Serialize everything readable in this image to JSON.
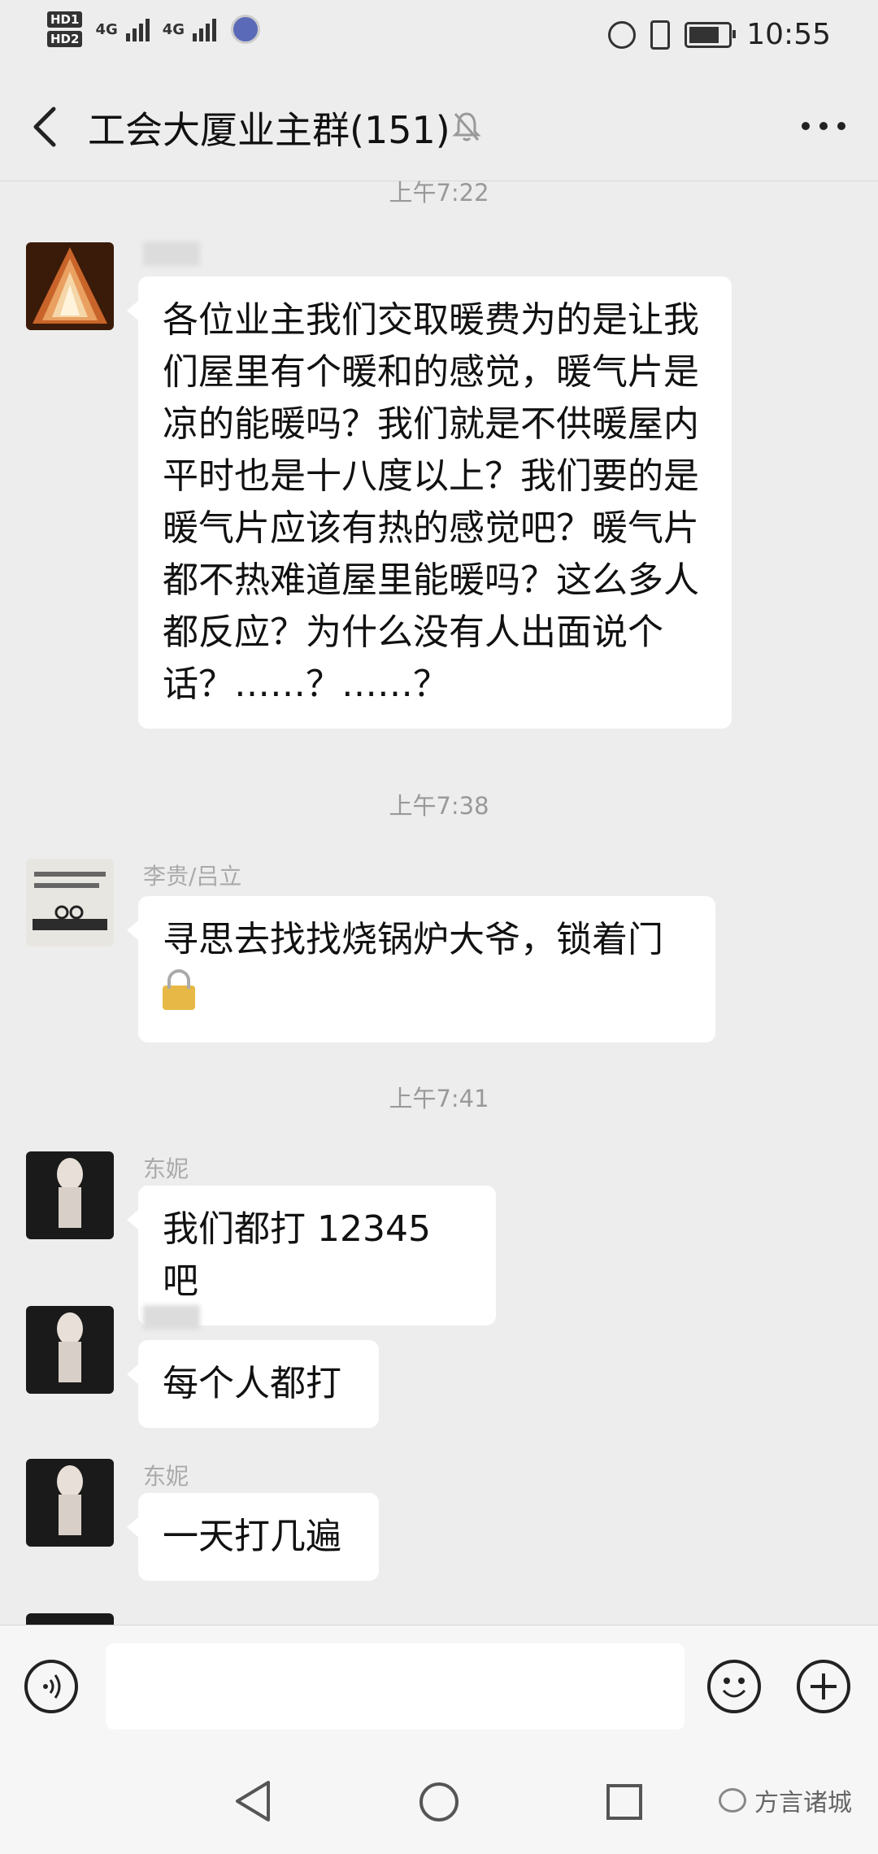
{
  "status_bar": {
    "hd1": "HD1",
    "hd2": "HD2",
    "net1": "4G",
    "net2": "4G",
    "time": "10:55"
  },
  "header": {
    "title": "工会大厦业主群(151)"
  },
  "timestamps": [
    "上午7:22",
    "上午7:38",
    "上午7:41"
  ],
  "messages": [
    {
      "sender": "",
      "text": "各位业主我们交取暖费为的是让我们屋里有个暖和的感觉，暖气片是凉的能暖吗？我们就是不供暖屋内平时也是十八度以上？我们要的是暖气片应该有热的感觉吧？暖气片都不热难道屋里能暖吗？这么多人都反应？为什么没有人出面说个话？……？……？"
    },
    {
      "sender": "李贵/吕立",
      "text": "寻思去找找烧锅炉大爷，锁着门"
    },
    {
      "sender": "东妮",
      "text": "我们都打 12345 吧"
    },
    {
      "sender": "",
      "text": "每个人都打"
    },
    {
      "sender": "东妮",
      "text": "一天打几遍"
    }
  ],
  "watermark": "方言诸城",
  "colors": {
    "background": "#ededed",
    "bubble": "#ffffff",
    "timestamp": "#999999"
  }
}
